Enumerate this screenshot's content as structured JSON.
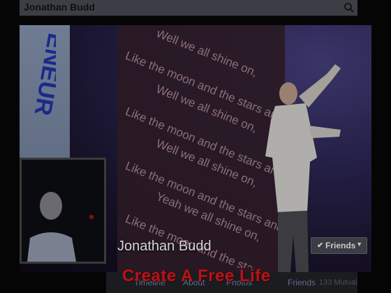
{
  "search": {
    "value": "Jonathan Budd"
  },
  "cover": {
    "panel_text": "ENEUR",
    "lyrics": [
      "Well we all shine on,",
      "Like the moon and the stars and the sun.",
      "Well we all shine on,",
      "Like the moon and the stars and the sun.",
      "Well we all shine on,",
      "Like the moon and the stars and the sun.",
      "Yeah we all shine on,",
      "Like the moon and the stars and the sun."
    ]
  },
  "profile": {
    "name": "Jonathan Budd"
  },
  "friends_button": {
    "label": "Friends"
  },
  "tabs": {
    "timeline": "Timeline",
    "about": "About",
    "photos": "Photos",
    "friends": "Friends",
    "friends_count": "133 Mutual"
  },
  "overlay": {
    "title": "Create A Free Life"
  },
  "colors": {
    "overlay_title": "#b8121c",
    "tab_link": "#5b6d8c",
    "background": "#050505"
  }
}
